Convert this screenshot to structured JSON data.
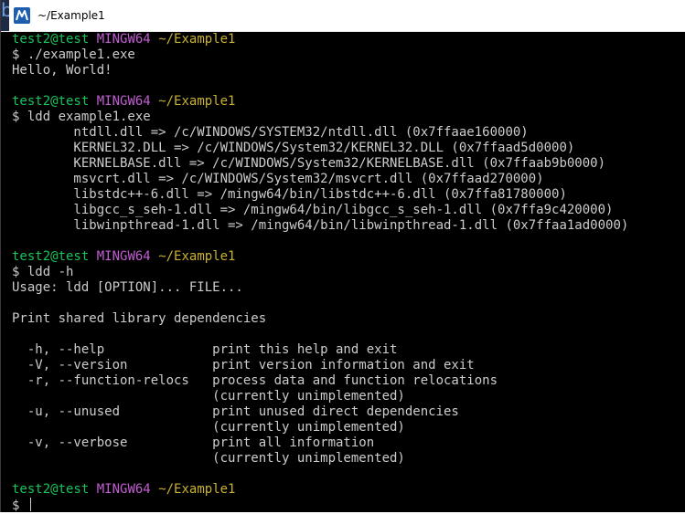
{
  "window": {
    "title": "~/Example1",
    "app_icon": "mintty-m-icon",
    "accent": "#1d5fae"
  },
  "behind_window_glyph": "b",
  "terminal": {
    "colors": {
      "user": "#19c35a",
      "shell": "#c25ed3",
      "path": "#c9b12f",
      "text": "#cccccc",
      "background": "#000000"
    },
    "prompts": [
      {
        "user": "test2@test",
        "shell": "MINGW64",
        "path": "~/Example1"
      },
      {
        "user": "test2@test",
        "shell": "MINGW64",
        "path": "~/Example1"
      },
      {
        "user": "test2@test",
        "shell": "MINGW64",
        "path": "~/Example1"
      },
      {
        "user": "test2@test",
        "shell": "MINGW64",
        "path": "~/Example1"
      }
    ],
    "commands": [
      "$ ./example1.exe",
      "$ ldd example1.exe",
      "$ ldd -h",
      "$ "
    ],
    "output": {
      "hello": "Hello, World!",
      "ldd": [
        "        ntdll.dll => /c/WINDOWS/SYSTEM32/ntdll.dll (0x7ffaae160000)",
        "        KERNEL32.DLL => /c/WINDOWS/System32/KERNEL32.DLL (0x7ffaad5d0000)",
        "        KERNELBASE.dll => /c/WINDOWS/System32/KERNELBASE.dll (0x7ffaab9b0000)",
        "        msvcrt.dll => /c/WINDOWS/System32/msvcrt.dll (0x7ffaad270000)",
        "        libstdc++-6.dll => /mingw64/bin/libstdc++-6.dll (0x7ffa81780000)",
        "        libgcc_s_seh-1.dll => /mingw64/bin/libgcc_s_seh-1.dll (0x7ffa9c420000)",
        "        libwinpthread-1.dll => /mingw64/bin/libwinpthread-1.dll (0x7ffaa1ad0000)"
      ],
      "help": {
        "usage": "Usage: ldd [OPTION]... FILE...",
        "description": "Print shared library dependencies",
        "options": [
          "  -h, --help              print this help and exit",
          "  -V, --version           print version information and exit",
          "  -r, --function-relocs   process data and function relocations",
          "                          (currently unimplemented)",
          "  -u, --unused            print unused direct dependencies",
          "                          (currently unimplemented)",
          "  -v, --verbose           print all information",
          "                          (currently unimplemented)"
        ]
      }
    }
  }
}
